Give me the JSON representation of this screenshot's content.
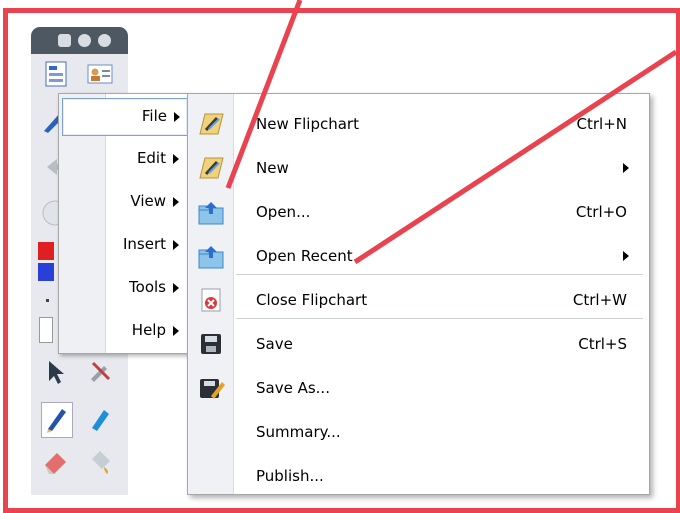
{
  "menu_bar": {
    "items": [
      {
        "label": "File",
        "selected": true
      },
      {
        "label": "Edit"
      },
      {
        "label": "View"
      },
      {
        "label": "Insert"
      },
      {
        "label": "Tools"
      },
      {
        "label": "Help"
      }
    ]
  },
  "file_menu": {
    "items": [
      {
        "label": "New Flipchart",
        "shortcut": "Ctrl+N",
        "icon": "flipchart-new-icon"
      },
      {
        "label": "New",
        "shortcut": "",
        "submenu": true,
        "icon": "flipchart-new-icon"
      },
      {
        "label": "Open...",
        "shortcut": "Ctrl+O",
        "icon": "open-folder-icon"
      },
      {
        "label": "Open Recent",
        "shortcut": "",
        "submenu": true,
        "icon": "open-folder-icon"
      },
      {
        "label": "Close Flipchart",
        "shortcut": "Ctrl+W",
        "icon": "close-red-icon"
      },
      {
        "label": "Save",
        "shortcut": "Ctrl+S",
        "icon": "save-icon"
      },
      {
        "label": "Save As...",
        "shortcut": "",
        "icon": "save-as-icon"
      },
      {
        "label": "Summary...",
        "shortcut": "",
        "icon": ""
      },
      {
        "label": "Publish...",
        "shortcut": "",
        "icon": ""
      }
    ]
  },
  "colors": {
    "annotation_red": "#e8434e",
    "toolbox_header": "#4d5863",
    "selection_border": "#7da2ce"
  }
}
